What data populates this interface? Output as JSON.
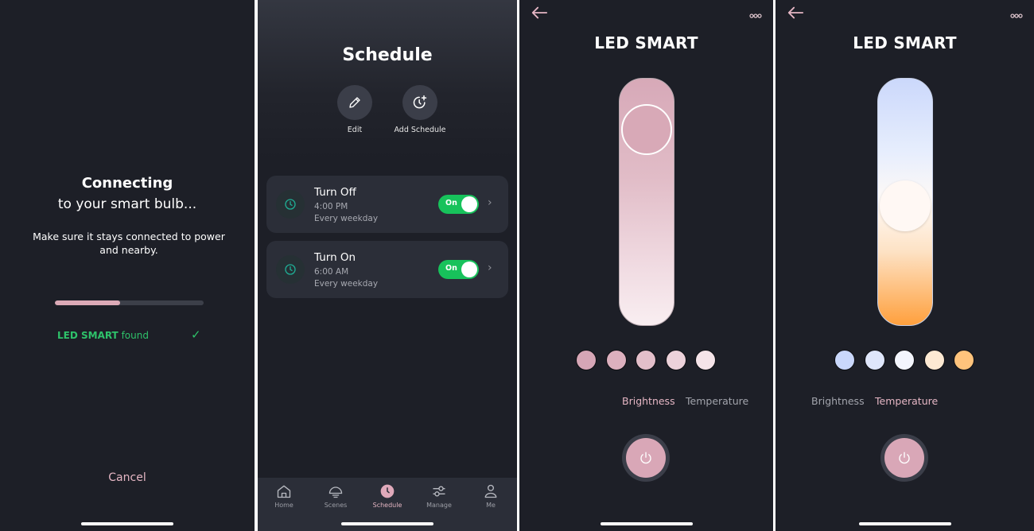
{
  "connecting": {
    "title": "Connecting",
    "subtitle": "to your smart bulb...",
    "description": "Make sure it stays connected to power and nearby.",
    "progress_percent": 44,
    "found_device": "LED SMART",
    "found_suffix": "found",
    "check_icon": "✓",
    "cancel_label": "Cancel"
  },
  "schedule": {
    "title": "Schedule",
    "actions": [
      {
        "label": "Edit",
        "icon": "pencil-icon"
      },
      {
        "label": "Add Schedule",
        "icon": "clock-plus-icon"
      }
    ],
    "items": [
      {
        "name": "Turn Off",
        "time": "4:00 PM",
        "repeat": "Every weekday",
        "toggle": "On",
        "enabled": true
      },
      {
        "name": "Turn On",
        "time": "6:00 AM",
        "repeat": "Every weekday",
        "toggle": "On",
        "enabled": true
      }
    ],
    "tabs": [
      {
        "label": "Home",
        "icon": "home-icon",
        "active": false
      },
      {
        "label": "Scenes",
        "icon": "bulb-icon",
        "active": false
      },
      {
        "label": "Schedule",
        "icon": "clock-icon",
        "active": true
      },
      {
        "label": "Manage",
        "icon": "sliders-icon",
        "active": false
      },
      {
        "label": "Me",
        "icon": "user-icon",
        "active": false
      }
    ]
  },
  "brightness_screen": {
    "title": "LED SMART",
    "slider_level_percent": 80,
    "swatches": [
      "#d6a6b6",
      "#dcb0be",
      "#e3bfca",
      "#ecd2da",
      "#f5e4e9"
    ],
    "modes": [
      "Brightness",
      "Temperature"
    ],
    "active_mode": "Brightness"
  },
  "temperature_screen": {
    "title": "LED SMART",
    "slider_level_percent": 50,
    "swatches": [
      "#c9d7fb",
      "#dfe6fb",
      "#f3f5fd",
      "#fde9d3",
      "#ffc37c"
    ],
    "modes": [
      "Brightness",
      "Temperature"
    ],
    "active_mode": "Temperature"
  },
  "colors": {
    "accent_pink": "#e5b6c4",
    "success_green": "#17c25b",
    "background": "#1d1f27"
  }
}
